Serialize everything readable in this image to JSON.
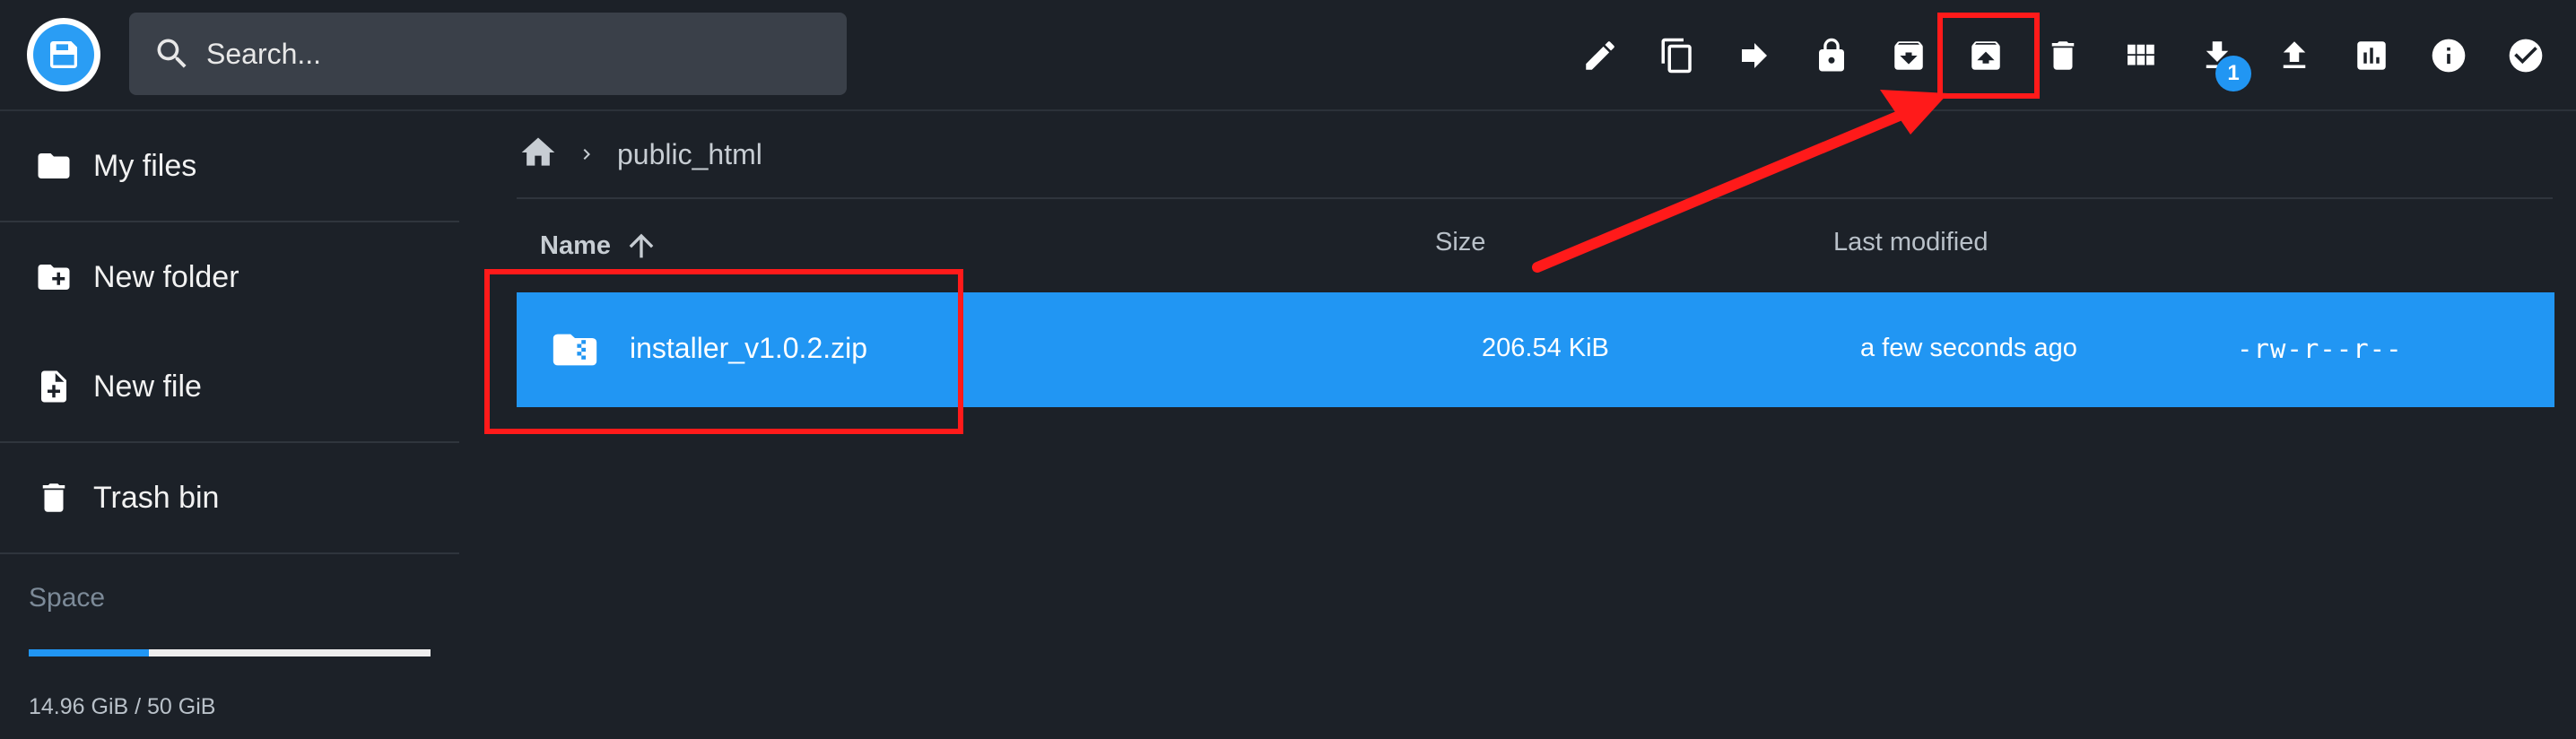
{
  "header": {
    "search_placeholder": "Search...",
    "toolbar": [
      {
        "name": "rename-icon"
      },
      {
        "name": "copy-icon"
      },
      {
        "name": "move-icon"
      },
      {
        "name": "permissions-icon"
      },
      {
        "name": "archive-icon"
      },
      {
        "name": "unarchive-icon"
      },
      {
        "name": "delete-icon"
      },
      {
        "name": "grid-view-icon"
      },
      {
        "name": "download-icon",
        "badge": "1"
      },
      {
        "name": "upload-icon"
      },
      {
        "name": "usage-icon"
      },
      {
        "name": "info-icon"
      },
      {
        "name": "select-all-icon"
      }
    ],
    "download_badge": "1"
  },
  "sidebar": {
    "items": [
      {
        "label": "My files",
        "icon": "folder-icon"
      },
      {
        "label": "New folder",
        "icon": "create-folder-icon"
      },
      {
        "label": "New file",
        "icon": "create-file-icon"
      },
      {
        "label": "Trash bin",
        "icon": "trash-icon"
      }
    ],
    "space": {
      "title": "Space",
      "usage": "14.96 GiB / 50 GiB",
      "used_fraction": 0.2992
    }
  },
  "breadcrumb": {
    "current": "public_html"
  },
  "listing": {
    "columns": {
      "name": "Name",
      "size": "Size",
      "modified": "Last modified"
    },
    "rows": [
      {
        "name": "installer_v1.0.2.zip",
        "size": "206.54 KiB",
        "modified": "a few seconds ago",
        "permissions": "-rw-r--r--",
        "selected": true
      }
    ]
  },
  "colors": {
    "background": "#1c2128",
    "accent": "#2196f3",
    "annotation": "#ff1a1a"
  }
}
